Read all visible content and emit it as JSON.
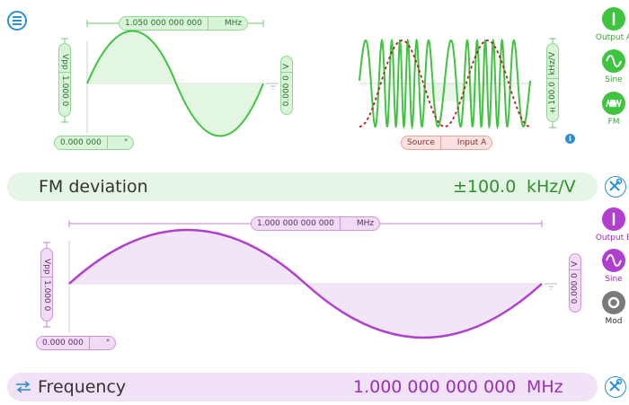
{
  "colors": {
    "green": "#3fc43f",
    "green_fill": "#dff5df",
    "purple": "#b03fce",
    "purple_fill": "#f2e2f7",
    "red_dash": "#c0182f",
    "blue": "#2a8fd6",
    "gray": "#7a7a7a"
  },
  "icons": {
    "menu": "menu-icon",
    "tool": "wrench-screwdriver-icon",
    "info": "info-icon",
    "swap": "swap-arrows-icon"
  },
  "channel_a": {
    "frequency_pill": {
      "value": "1.050 000 000 000",
      "unit": "MHz"
    },
    "amplitude_pill": {
      "value": "1.000 0",
      "unit": "Vpp"
    },
    "offset_pill": {
      "value": "0.000 0",
      "unit": "V"
    },
    "phase_pill": {
      "value": "0.000 000",
      "unit": "°"
    },
    "fm_preview": {
      "sensitivity": "±100.0",
      "unit": "kHz/V"
    },
    "source_pill": {
      "label": "Source",
      "value": "Input A"
    },
    "side": {
      "output": "Output A",
      "wave": "Sine",
      "mod": "FM"
    }
  },
  "fm_bar": {
    "label": "FM deviation",
    "value": "±100.0",
    "unit": "kHz/V"
  },
  "channel_b": {
    "frequency_pill": {
      "value": "1.000 000 000 000",
      "unit": "MHz"
    },
    "amplitude_pill": {
      "value": "1.000 0",
      "unit": "Vpp"
    },
    "offset_pill": {
      "value": "0.000 0",
      "unit": "V"
    },
    "phase_pill": {
      "value": "0.000 000",
      "unit": "°"
    },
    "side": {
      "output": "Output B",
      "wave": "Sine",
      "mod": "Mod"
    }
  },
  "freq_bar": {
    "label": "Frequency",
    "value": "1.000 000 000 000",
    "unit": "MHz"
  }
}
